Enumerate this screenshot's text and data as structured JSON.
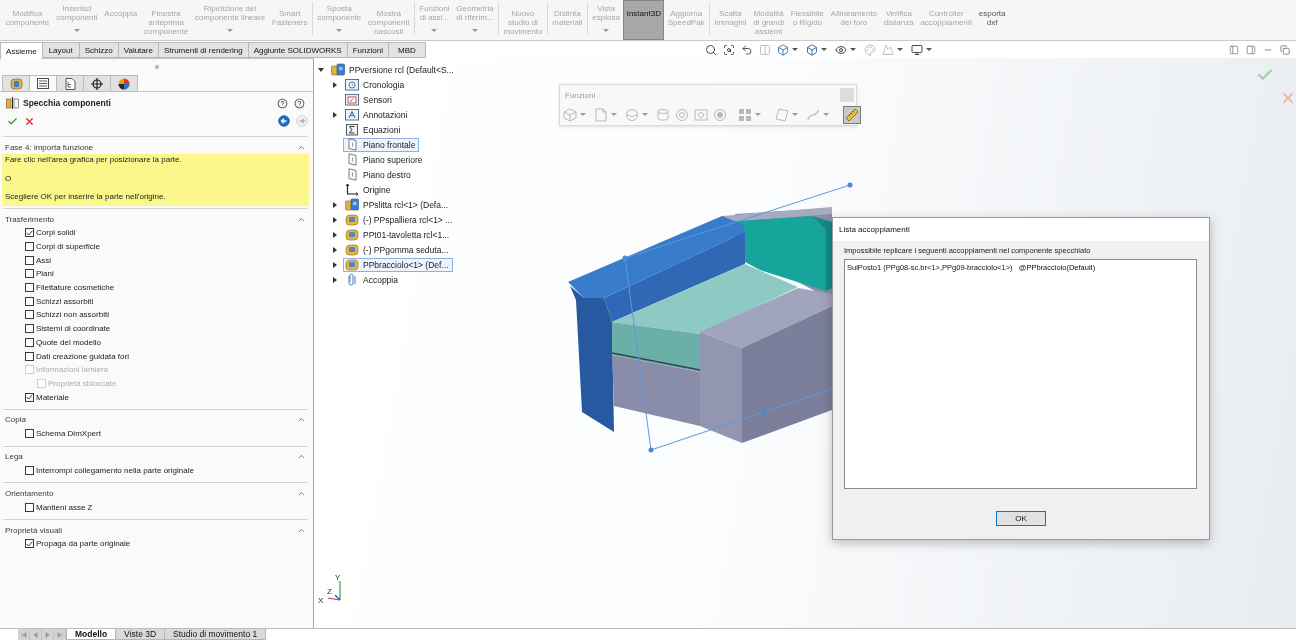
{
  "ribbon": {
    "groups": [
      [
        {
          "lines": [
            "Modifica",
            "componente"
          ],
          "dropdown": false,
          "disabled": true,
          "selected": false
        },
        {
          "lines": [
            "Inserisci",
            "componenti"
          ],
          "dropdown": true,
          "disabled": true,
          "selected": false
        },
        {
          "lines": [
            "Accoppia"
          ],
          "dropdown": false,
          "disabled": true,
          "selected": false
        },
        {
          "lines": [
            "Finestra",
            "anteprima",
            "componente"
          ],
          "dropdown": false,
          "disabled": true,
          "selected": false
        },
        {
          "lines": [
            "Ripetizione del",
            "componente lineare"
          ],
          "dropdown": true,
          "disabled": true,
          "selected": false
        },
        {
          "lines": [
            "Smart",
            "Fasteners"
          ],
          "dropdown": false,
          "disabled": true,
          "selected": false
        }
      ],
      [
        {
          "lines": [
            "Sposta",
            "componente"
          ],
          "dropdown": true,
          "disabled": true,
          "selected": false
        },
        {
          "lines": [
            "Mostra",
            "componenti",
            "nascosti"
          ],
          "dropdown": false,
          "disabled": true,
          "selected": false
        }
      ],
      [
        {
          "lines": [
            "Funzioni",
            "di assi..."
          ],
          "dropdown": true,
          "disabled": true,
          "selected": false
        },
        {
          "lines": [
            "Geometria",
            "di riferim..."
          ],
          "dropdown": true,
          "disabled": true,
          "selected": false
        }
      ],
      [
        {
          "lines": [
            "Nuovo",
            "studio di",
            "movimento"
          ],
          "dropdown": false,
          "disabled": true,
          "selected": false
        }
      ],
      [
        {
          "lines": [
            "Distinta",
            "materiali"
          ],
          "dropdown": false,
          "disabled": true,
          "selected": false
        }
      ],
      [
        {
          "lines": [
            "Vista",
            "esplosa"
          ],
          "dropdown": true,
          "disabled": true,
          "selected": false
        },
        {
          "lines": [
            "Instant3D"
          ],
          "dropdown": false,
          "disabled": false,
          "selected": true
        },
        {
          "lines": [
            "Aggiorna",
            "SpeedPak"
          ],
          "dropdown": false,
          "disabled": true,
          "selected": false
        }
      ],
      [
        {
          "lines": [
            "Scatta",
            "immagini"
          ],
          "dropdown": false,
          "disabled": true,
          "selected": false
        },
        {
          "lines": [
            "Modalità",
            "di grandi",
            "assiemi"
          ],
          "dropdown": false,
          "disabled": true,
          "selected": false
        },
        {
          "lines": [
            "Flessibile",
            "o Rigido"
          ],
          "dropdown": false,
          "disabled": true,
          "selected": false
        },
        {
          "lines": [
            "Allineamento",
            "del foro"
          ],
          "dropdown": false,
          "disabled": true,
          "selected": false
        },
        {
          "lines": [
            "Verifica",
            "distanza"
          ],
          "dropdown": false,
          "disabled": true,
          "selected": false
        },
        {
          "lines": [
            "Controller",
            "accoppiamenti"
          ],
          "dropdown": false,
          "disabled": true,
          "selected": false
        },
        {
          "lines": [
            "esporta",
            "dxf"
          ],
          "dropdown": false,
          "disabled": false,
          "selected": false
        }
      ]
    ]
  },
  "command_tabs": [
    {
      "label": "Assieme",
      "selected": true
    },
    {
      "label": "Layout",
      "selected": false
    },
    {
      "label": "Schizzo",
      "selected": false
    },
    {
      "label": "Valutare",
      "selected": false
    },
    {
      "label": "Strumenti di rendering",
      "selected": false
    },
    {
      "label": "Aggiunte SOLIDWORKS",
      "selected": false
    },
    {
      "label": "Funzioni",
      "selected": false
    },
    {
      "label": "MBD",
      "selected": false
    }
  ],
  "view_toolbar": {
    "buttons": [
      {
        "dropdown": false,
        "disabled": false
      },
      {
        "dropdown": false,
        "disabled": false
      },
      {
        "dropdown": false,
        "disabled": false
      },
      {
        "dropdown": false,
        "disabled": true
      },
      {
        "dropdown": true,
        "disabled": false
      },
      {
        "dropdown": true,
        "disabled": false
      },
      {
        "dropdown": true,
        "disabled": false
      },
      {
        "dropdown": false,
        "disabled": true
      },
      {
        "dropdown": true,
        "disabled": true
      },
      {
        "dropdown": true,
        "disabled": false
      }
    ]
  },
  "property_manager": {
    "tabs": [
      {
        "selected": false
      },
      {
        "selected": true
      },
      {
        "selected": false
      },
      {
        "selected": false
      },
      {
        "selected": false
      }
    ],
    "title": "Specchia componenti",
    "navigation": [
      {
        "disabled": false
      },
      {
        "disabled": true
      }
    ],
    "sections": [
      {
        "title": "Fase 4: importa funzione",
        "expanded": true,
        "kind": "message",
        "lines": [
          "Fare clic nell'area grafica per posizionare la parte.",
          "O",
          "Scegliere OK per inserire la parte nell'origine."
        ]
      },
      {
        "title": "Trasferimento",
        "expanded": true,
        "kind": "options",
        "options": [
          {
            "label": "Corpi solidi",
            "checked": true,
            "disabled": false
          },
          {
            "label": "Corpi di superficie",
            "checked": false,
            "disabled": false
          },
          {
            "label": "Assi",
            "checked": false,
            "disabled": false
          },
          {
            "label": "Piani",
            "checked": false,
            "disabled": false
          },
          {
            "label": "Filettature cosmetiche",
            "checked": false,
            "disabled": false
          },
          {
            "label": "Schizzi assorbiti",
            "checked": false,
            "disabled": false
          },
          {
            "label": "Schizzi non assorbiti",
            "checked": false,
            "disabled": false
          },
          {
            "label": "Sistemi di coordinate",
            "checked": false,
            "disabled": false
          },
          {
            "label": "Quote del modello",
            "checked": false,
            "disabled": false
          },
          {
            "label": "Dati creazione guidata fori",
            "checked": false,
            "disabled": false
          },
          {
            "label": "Informazioni lamiera",
            "checked": false,
            "disabled": true,
            "children": [
              {
                "label": "Proprietà sbloccate",
                "checked": false,
                "disabled": true
              }
            ]
          },
          {
            "label": "Materiale",
            "checked": true,
            "disabled": false
          }
        ]
      },
      {
        "title": "Copia",
        "expanded": true,
        "kind": "options",
        "options": [
          {
            "label": "Schema DimXpert",
            "checked": false,
            "disabled": false
          }
        ]
      },
      {
        "title": "Lega",
        "expanded": true,
        "kind": "options",
        "options": [
          {
            "label": "Interrompi collegamento nella parte originale",
            "checked": false,
            "disabled": false
          }
        ]
      },
      {
        "title": "Orientamento",
        "expanded": true,
        "kind": "options",
        "options": [
          {
            "label": "Mantieni asse Z",
            "checked": false,
            "disabled": false
          }
        ]
      },
      {
        "title": "Proprietà visuali",
        "expanded": true,
        "kind": "options",
        "options": [
          {
            "label": "Propaga da parte originale",
            "checked": true,
            "disabled": false
          }
        ]
      }
    ]
  },
  "feature_tree": {
    "root": {
      "label": "PPversione rcl (Default<S...",
      "kind": "assembly",
      "expandable": true,
      "expanded": true,
      "selected": false,
      "children": [
        {
          "label": "Cronologia",
          "kind": "history",
          "expandable": true,
          "expanded": false,
          "selected": false
        },
        {
          "label": "Sensori",
          "kind": "sensors",
          "expandable": false,
          "selected": false
        },
        {
          "label": "Annotazioni",
          "kind": "annotations",
          "expandable": true,
          "expanded": false,
          "selected": false
        },
        {
          "label": "Equazioni",
          "kind": "equations",
          "expandable": false,
          "selected": false
        },
        {
          "label": "Piano frontale",
          "kind": "plane",
          "expandable": false,
          "selected": true
        },
        {
          "label": "Piano superiore",
          "kind": "plane",
          "expandable": false,
          "selected": false
        },
        {
          "label": "Piano destro",
          "kind": "plane",
          "expandable": false,
          "selected": false
        },
        {
          "label": "Origine",
          "kind": "origin",
          "expandable": false,
          "selected": false
        },
        {
          "label": "PPslitta rcl<1> (Defa...",
          "kind": "assembly",
          "expandable": true,
          "expanded": false,
          "selected": false
        },
        {
          "label": "(-) PPspalliera rcl<1> ...",
          "kind": "part",
          "expandable": true,
          "expanded": false,
          "selected": false
        },
        {
          "label": "PPt01-tavoletta rcl<1...",
          "kind": "part",
          "expandable": true,
          "expanded": false,
          "selected": false
        },
        {
          "label": "(-) PPgomma seduta...",
          "kind": "part",
          "expandable": true,
          "expanded": false,
          "selected": false
        },
        {
          "label": "PPbracciolo<1> (Def...",
          "kind": "part",
          "expandable": true,
          "expanded": false,
          "selected": true
        },
        {
          "label": "Accoppia",
          "kind": "mates",
          "expandable": true,
          "expanded": false,
          "selected": false
        }
      ]
    }
  },
  "features_toolbar": {
    "title": "Funzioni",
    "groups": [
      [
        {
          "dropdown": true,
          "disabled": true,
          "selected": false
        },
        {
          "dropdown": true,
          "disabled": true,
          "selected": false
        },
        {
          "dropdown": true,
          "disabled": true,
          "selected": false
        },
        {
          "dropdown": false,
          "disabled": true,
          "selected": false
        },
        {
          "dropdown": false,
          "disabled": true,
          "selected": false
        },
        {
          "dropdown": false,
          "disabled": true,
          "selected": false
        },
        {
          "dropdown": false,
          "disabled": true,
          "selected": false
        }
      ],
      [
        {
          "dropdown": true,
          "disabled": true,
          "selected": false
        }
      ],
      [
        {
          "dropdown": true,
          "disabled": true,
          "selected": false
        },
        {
          "dropdown": true,
          "disabled": true,
          "selected": false
        }
      ],
      [
        {
          "dropdown": false,
          "disabled": false,
          "selected": true
        }
      ]
    ]
  },
  "triad": {
    "labels": [
      "Y",
      "Z",
      "X"
    ]
  },
  "dialog": {
    "title": "Lista accoppiamenti",
    "message": "Impossibile replicare i seguenti accoppiamenti nel componente specchiato",
    "items": [
      "SulPosto1 (PPg08-sc.br<1>,PPg09-bracciolo<1>)   @PPbracciolo(Default)"
    ],
    "buttons": [
      "OK"
    ]
  },
  "bottom_tabs": [
    {
      "label": "Modello",
      "selected": true
    },
    {
      "label": "Viste 3D",
      "selected": false
    },
    {
      "label": "Studio di movimento 1",
      "selected": false
    }
  ]
}
